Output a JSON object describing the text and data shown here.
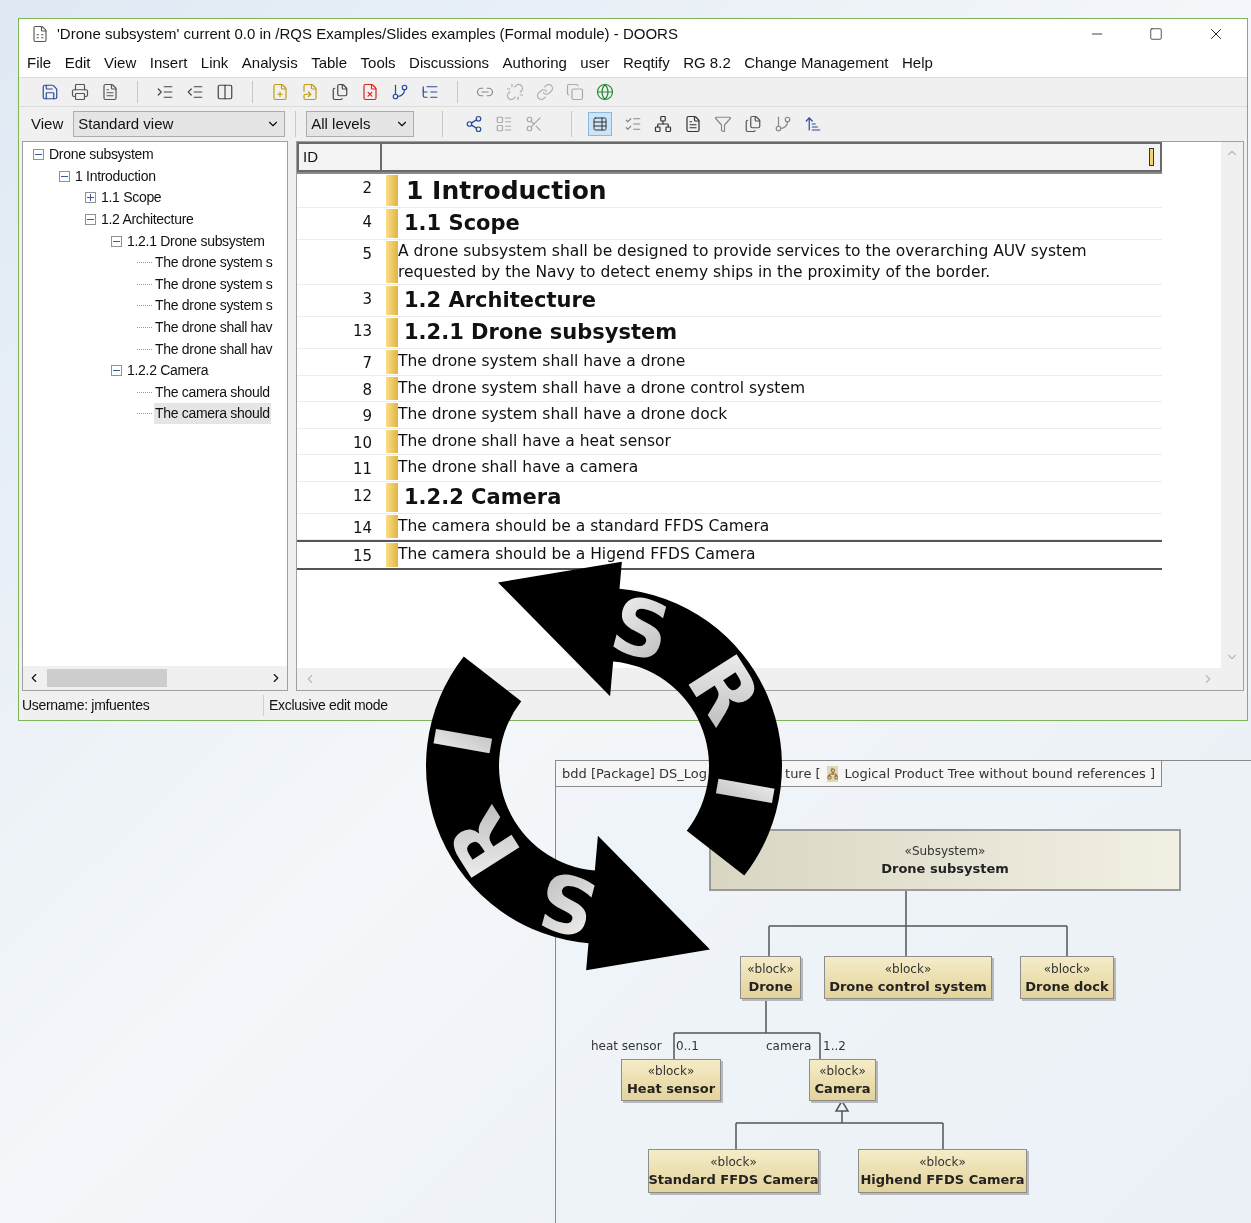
{
  "window": {
    "title": "'Drone subsystem' current 0.0 in /RQS Examples/Slides examples (Formal module) - DOORS"
  },
  "menu": [
    "File",
    "Edit",
    "View",
    "Insert",
    "Link",
    "Analysis",
    "Table",
    "Tools",
    "Discussions",
    "Authoring",
    "user",
    "Reqtify",
    "RG 8.2",
    "Change Management",
    "Help"
  ],
  "view_selector": {
    "label": "View",
    "value": "Standard view"
  },
  "levels_selector": {
    "value": "All levels"
  },
  "tree": [
    {
      "label": "Drone subsystem",
      "expanded": true,
      "selected": false,
      "children": [
        {
          "label": "1 Introduction",
          "expanded": true,
          "selected": false,
          "children": [
            {
              "label": "1.1 Scope",
              "expanded": false,
              "selected": false
            },
            {
              "label": "1.2 Architecture",
              "expanded": true,
              "selected": false,
              "children": [
                {
                  "label": "1.2.1 Drone subsystem",
                  "expanded": true,
                  "selected": false,
                  "children": [
                    {
                      "label": "The drone system s",
                      "selected": false
                    },
                    {
                      "label": "The drone system s",
                      "selected": false
                    },
                    {
                      "label": "The drone system s",
                      "selected": false
                    },
                    {
                      "label": "The drone shall hav",
                      "selected": false
                    },
                    {
                      "label": "The drone shall hav",
                      "selected": false
                    }
                  ]
                },
                {
                  "label": "1.2.2 Camera",
                  "expanded": true,
                  "selected": false,
                  "children": [
                    {
                      "label": "The camera should",
                      "selected": false
                    },
                    {
                      "label": "The camera should",
                      "selected": true
                    }
                  ]
                }
              ]
            }
          ]
        }
      ]
    }
  ],
  "grid": {
    "columns": [
      "ID"
    ],
    "rows": [
      {
        "id": "2",
        "kind": "heading1",
        "text": "1 Introduction",
        "selected": false
      },
      {
        "id": "4",
        "kind": "heading2",
        "text": "1.1 Scope",
        "selected": false
      },
      {
        "id": "5",
        "kind": "text",
        "text": "A drone subsystem shall be designed to provide services to the overarching AUV system requested by the Navy to detect enemy ships in the proximity of the border.",
        "selected": false
      },
      {
        "id": "3",
        "kind": "heading2",
        "text": "1.2 Architecture",
        "selected": false
      },
      {
        "id": "13",
        "kind": "heading2",
        "text": "1.2.1 Drone subsystem",
        "selected": false
      },
      {
        "id": "7",
        "kind": "text",
        "text": "The drone system shall have a drone",
        "selected": false
      },
      {
        "id": "8",
        "kind": "text",
        "text": "The drone system shall have a drone control system",
        "selected": false
      },
      {
        "id": "9",
        "kind": "text",
        "text": "The drone system shall have a drone dock",
        "selected": false
      },
      {
        "id": "10",
        "kind": "text",
        "text": "The drone shall have a heat sensor",
        "selected": false
      },
      {
        "id": "11",
        "kind": "text",
        "text": "The drone shall have a camera",
        "selected": false
      },
      {
        "id": "12",
        "kind": "heading2",
        "text": "1.2.2 Camera",
        "selected": false
      },
      {
        "id": "14",
        "kind": "text",
        "text": "The camera should be a standard FFDS Camera",
        "selected": false
      },
      {
        "id": "15",
        "kind": "text",
        "text": "The camera should be a Higend FFDS Camera",
        "selected": true
      }
    ]
  },
  "status_bar": [
    "Username: jmfuentes",
    "Exclusive edit mode"
  ],
  "logo": {
    "arcs": [
      "SRI",
      "SRI"
    ]
  },
  "diagram": {
    "title_parts": [
      "bdd [Package] DS_Log",
      "ture ["
    ],
    "diagram_name": "Logical Product Tree without bound references ]",
    "nodes": [
      {
        "kind": "subsystem",
        "stereotype": "«Subsystem»",
        "name": "Drone subsystem"
      },
      {
        "kind": "block",
        "stereotype": "«block»",
        "name": "Drone"
      },
      {
        "kind": "block",
        "stereotype": "«block»",
        "name": "Drone control system"
      },
      {
        "kind": "block",
        "stereotype": "«block»",
        "name": "Drone dock"
      },
      {
        "kind": "block",
        "stereotype": "«block»",
        "name": "Heat sensor"
      },
      {
        "kind": "block",
        "stereotype": "«block»",
        "name": "Camera"
      },
      {
        "kind": "block",
        "stereotype": "«block»",
        "name": "Standard FFDS Camera"
      },
      {
        "kind": "block",
        "stereotype": "«block»",
        "name": "Highend FFDS Camera"
      }
    ],
    "labels": [
      "heat sensor",
      "0..1",
      "camera",
      "1..2"
    ]
  }
}
